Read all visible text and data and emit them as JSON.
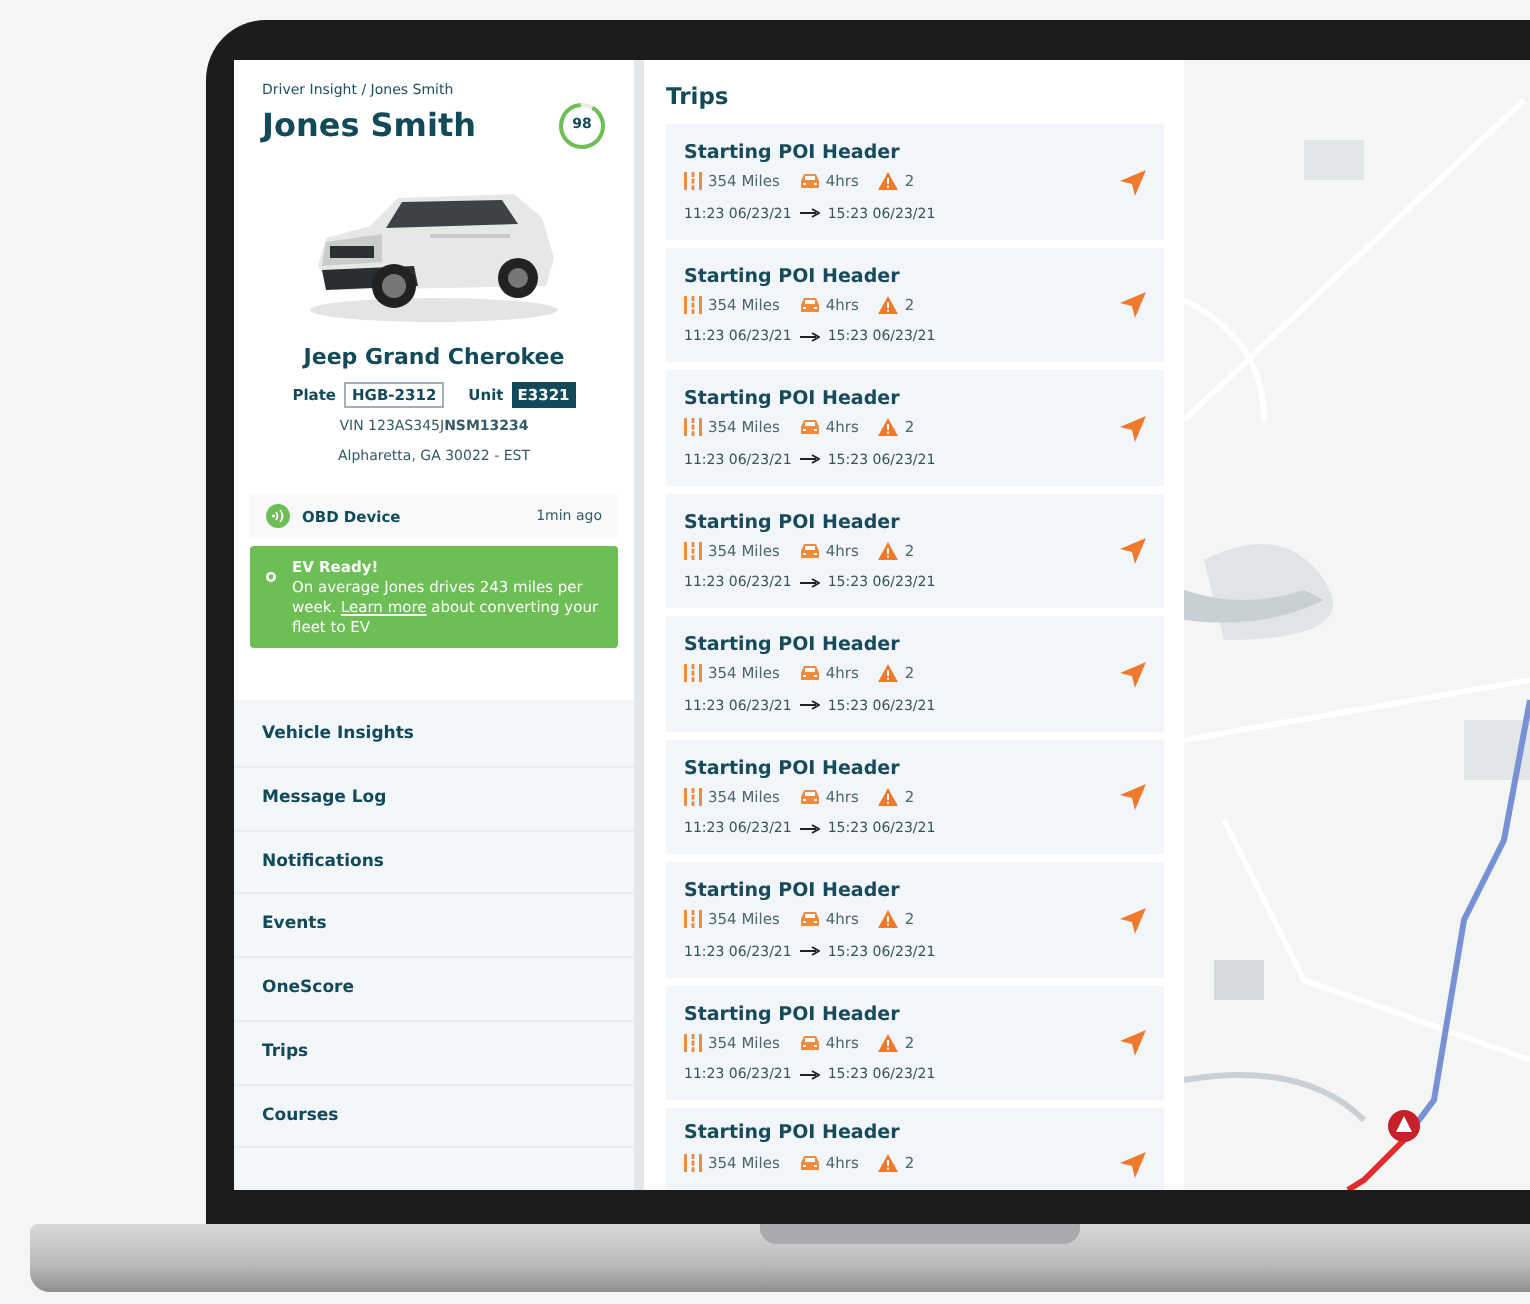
{
  "driver": {
    "breadcrumb": "Driver Insight / Jones Smith",
    "name": "Jones Smith",
    "score": "98"
  },
  "vehicle": {
    "model": "Jeep Grand Cherokee",
    "plate_label": "Plate",
    "plate": "HGB-2312",
    "unit_label": "Unit",
    "unit": "E3321",
    "vin": "VIN 123AS345J**NSM13234**",
    "location": "Alpharetta, GA 30022 - EST"
  },
  "device": {
    "label": "OBD Device",
    "time": "1min ago"
  },
  "ev_banner": {
    "title": "EV Ready!",
    "text_before": "On average Jones drives 243 miles per week. ",
    "link": "Learn more",
    "text_after": " about converting your fleet to EV"
  },
  "nav": [
    {
      "label": "Vehicle Insights",
      "selected": false
    },
    {
      "label": "Message Log",
      "selected": false
    },
    {
      "label": "Notifications",
      "selected": false
    },
    {
      "label": "Events",
      "selected": false
    },
    {
      "label": "OneScore",
      "selected": false
    },
    {
      "label": "Trips",
      "selected": false
    },
    {
      "label": "Courses",
      "selected": false
    }
  ],
  "trips": {
    "title": "Trips",
    "items": [
      {
        "header": "Starting POI Header",
        "distance": "354 Miles",
        "duration": "4hrs",
        "alerts": "2",
        "start": "11:23 06/23/21",
        "end": "15:23 06/23/21"
      },
      {
        "header": "Starting POI Header",
        "distance": "354 Miles",
        "duration": "4hrs",
        "alerts": "2",
        "start": "11:23 06/23/21",
        "end": "15:23 06/23/21"
      },
      {
        "header": "Starting POI Header",
        "distance": "354 Miles",
        "duration": "4hrs",
        "alerts": "2",
        "start": "11:23 06/23/21",
        "end": "15:23 06/23/21"
      },
      {
        "header": "Starting POI Header",
        "distance": "354 Miles",
        "duration": "4hrs",
        "alerts": "2",
        "start": "11:23 06/23/21",
        "end": "15:23 06/23/21"
      },
      {
        "header": "Starting POI Header",
        "distance": "354 Miles",
        "duration": "4hrs",
        "alerts": "2",
        "start": "11:23 06/23/21",
        "end": "15:23 06/23/21"
      },
      {
        "header": "Starting POI Header",
        "distance": "354 Miles",
        "duration": "4hrs",
        "alerts": "2",
        "start": "11:23 06/23/21",
        "end": "15:23 06/23/21"
      },
      {
        "header": "Starting POI Header",
        "distance": "354 Miles",
        "duration": "4hrs",
        "alerts": "2",
        "start": "11:23 06/23/21",
        "end": "15:23 06/23/21"
      },
      {
        "header": "Starting POI Header",
        "distance": "354 Miles",
        "duration": "4hrs",
        "alerts": "2",
        "start": "11:23 06/23/21",
        "end": "15:23 06/23/21"
      },
      {
        "header": "Starting POI Header",
        "distance": "354 Miles",
        "duration": "4hrs",
        "alerts": "2"
      }
    ]
  }
}
